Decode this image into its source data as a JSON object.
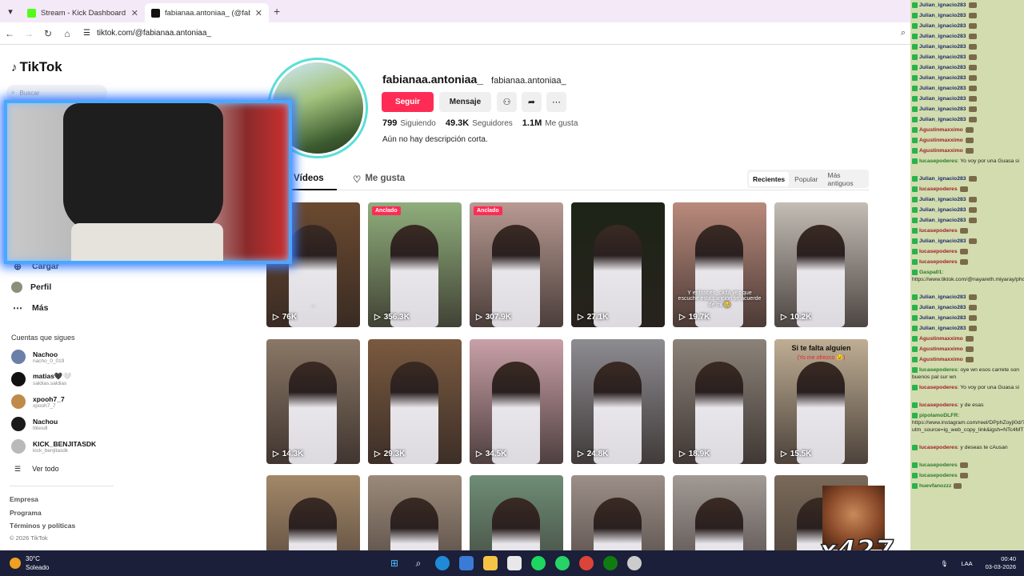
{
  "browser": {
    "tabs": [
      {
        "title": "Stream - Kick Dashboard",
        "favicon_color": "#53fc18"
      },
      {
        "title": "fabianaa.antoniaa_ (@fabia",
        "favicon_color": "#111111"
      }
    ],
    "url": "tiktok.com/@fabianaa.antoniaa_"
  },
  "sidebar": {
    "logo": "TikTok",
    "search_placeholder": "Buscar",
    "nav": [
      {
        "label": "Cargar",
        "icon": "upload-icon"
      },
      {
        "label": "Perfil",
        "icon": "profile-icon"
      },
      {
        "label": "Más",
        "icon": "more-icon"
      }
    ],
    "following_title": "Cuentas que sigues",
    "following": [
      {
        "name": "Nachoo",
        "handle": "nacho_0_019",
        "color": "#6c7fa8"
      },
      {
        "name": "matias🖤🤍",
        "handle": "saldias.saldias",
        "color": "#111111"
      },
      {
        "name": "xpooh7_7",
        "handle": "xpooh7_7",
        "color": "#c08a4a"
      },
      {
        "name": "Nachou",
        "handle": "lblesdl",
        "color": "#1a1a1a"
      },
      {
        "name": "KICK_BENJITASDK",
        "handle": "kick_benjitasdk",
        "color": "#b9b9b9"
      }
    ],
    "see_all": "Ver todo",
    "footer": [
      "Empresa",
      "Programa",
      "Términos y políticas"
    ],
    "copyright": "© 2026 TikTok"
  },
  "profile": {
    "username": "fabianaa.antoniaa_",
    "nickname": "fabianaa.antoniaa_",
    "follow_label": "Seguir",
    "message_label": "Mensaje",
    "stats": [
      {
        "value": "799",
        "label": "Siguiendo"
      },
      {
        "value": "49.3K",
        "label": "Seguidores"
      },
      {
        "value": "1.1M",
        "label": "Me gusta"
      }
    ],
    "bio": "Aún no hay descripción corta."
  },
  "tabs": {
    "videos": "Vídeos",
    "likes": "Me gusta"
  },
  "sort": [
    "Recientes",
    "Popular",
    "Más antiguos"
  ],
  "videos": [
    {
      "views": "76K",
      "pinned": "",
      "caption": "...",
      "bg": "#6b4a30"
    },
    {
      "views": "356.3K",
      "pinned": "Anclado",
      "caption": "",
      "bg": "#8fae7c"
    },
    {
      "views": "307.9K",
      "pinned": "Anclado",
      "caption": "",
      "bg": "#b89a92"
    },
    {
      "views": "27.1K",
      "pinned": "",
      "caption": "",
      "bg": "#1d2416"
    },
    {
      "views": "19.7K",
      "pinned": "",
      "caption": "Y entonces, cada vez que escuche esta canción se acuerde de mi 🥹",
      "bg": "#b98a7c"
    },
    {
      "views": "10.2K",
      "pinned": "",
      "caption": "",
      "bg": "#c4bdb5"
    },
    {
      "views": "14.3K",
      "pinned": "",
      "caption": "",
      "bg": "#8a7766"
    },
    {
      "views": "29.3K",
      "pinned": "",
      "caption": "",
      "bg": "#7a5a40"
    },
    {
      "views": "34.5K",
      "pinned": "",
      "caption": "",
      "bg": "#c9a0a8"
    },
    {
      "views": "24.8K",
      "pinned": "",
      "caption": "",
      "bg": "#8d8c91"
    },
    {
      "views": "18.9K",
      "pinned": "",
      "caption": "",
      "bg": "#8b8279"
    },
    {
      "views": "15.5K",
      "pinned": "",
      "caption": "",
      "bg": "#bfae94",
      "headline": "Si te falta alguien",
      "sub": "(Yo me ofrezco 😉)"
    },
    {
      "views": "",
      "pinned": "",
      "caption": "",
      "bg": "#a38869"
    },
    {
      "views": "",
      "pinned": "",
      "caption": "",
      "bg": "#9b8a7a"
    },
    {
      "views": "",
      "pinned": "",
      "caption": "",
      "bg": "#6e8d76"
    },
    {
      "views": "",
      "pinned": "",
      "caption": "",
      "bg": "#9c8f88"
    },
    {
      "views": "",
      "pinned": "",
      "caption": "",
      "bg": "#a29a95"
    },
    {
      "views": "",
      "pinned": "",
      "caption": "",
      "bg": "#7a6a5a"
    }
  ],
  "chat": [
    {
      "user": "Julian_ignacio283",
      "text": "",
      "c": "u"
    },
    {
      "user": "Julian_ignacio283",
      "text": "",
      "c": "u"
    },
    {
      "user": "Julian_ignacio283",
      "text": "",
      "c": "u"
    },
    {
      "user": "Julian_ignacio283",
      "text": "",
      "c": "u"
    },
    {
      "user": "Julian_ignacio283",
      "text": "",
      "c": "u"
    },
    {
      "user": "Julian_ignacio283",
      "text": "",
      "c": "u"
    },
    {
      "user": "Julian_ignacio283",
      "text": "",
      "c": "u"
    },
    {
      "user": "Julian_ignacio283",
      "text": "",
      "c": "u"
    },
    {
      "user": "Julian_ignacio283",
      "text": "",
      "c": "u"
    },
    {
      "user": "Julian_ignacio283",
      "text": "",
      "c": "u"
    },
    {
      "user": "Julian_ignacio283",
      "text": "",
      "c": "u"
    },
    {
      "user": "Julian_ignacio283",
      "text": "",
      "c": "u"
    },
    {
      "user": "Agustinmaxximo",
      "text": "",
      "c": "red"
    },
    {
      "user": "Agustinmaxximo",
      "text": "",
      "c": "red"
    },
    {
      "user": "Agustinmaxximo",
      "text": "",
      "c": "red"
    },
    {
      "user": "lucasepoderes",
      "text": ": Yo voy por una Guasa si",
      "c": "grn"
    },
    {
      "user": "Julian_ignacio283",
      "text": "",
      "c": "u"
    },
    {
      "user": "lucasepoderes",
      "text": "",
      "c": "red"
    },
    {
      "user": "Julian_ignacio283",
      "text": "",
      "c": "u"
    },
    {
      "user": "Julian_ignacio283",
      "text": "",
      "c": "u"
    },
    {
      "user": "Julian_ignacio283",
      "text": "",
      "c": "u"
    },
    {
      "user": "lucasepoderes",
      "text": "",
      "c": "red"
    },
    {
      "user": "Julian_ignacio283",
      "text": "",
      "c": "u"
    },
    {
      "user": "lucasepoderes",
      "text": "",
      "c": "red"
    },
    {
      "user": "lucasepoderes",
      "text": "",
      "c": "red"
    },
    {
      "user": "Gaspa01",
      "text": ": https://www.tiktok.com/@nayareth.miyaray/photo/75961840675559570",
      "c": "grn"
    },
    {
      "user": "Julian_ignacio283",
      "text": "",
      "c": "u"
    },
    {
      "user": "Julian_ignacio283",
      "text": "",
      "c": "u"
    },
    {
      "user": "Julian_ignacio283",
      "text": "",
      "c": "u"
    },
    {
      "user": "Julian_ignacio283",
      "text": "",
      "c": "u"
    },
    {
      "user": "Agustinmaxximo",
      "text": "",
      "c": "red"
    },
    {
      "user": "Agustinmaxximo",
      "text": "",
      "c": "red"
    },
    {
      "user": "Agustinmaxximo",
      "text": "",
      "c": "red"
    },
    {
      "user": "lucasepoderes",
      "text": ": oye wn esos carrete son buenos pal sur wn",
      "c": "grn"
    },
    {
      "user": "lucasepoderes",
      "text": ": Yo voy por una Guasa si",
      "c": "red"
    },
    {
      "user": "lucasepoderes",
      "text": ": y de esas",
      "c": "red"
    },
    {
      "user": "pipolamoDLFR",
      "text": ": https://www.instagram.com/reel/DPphZoyjI0d/?utm_source=ig_web_copy_link&igsh=NTc4MTIwNjQ2YQ==",
      "c": "grn"
    },
    {
      "user": "lucasepoderes",
      "text": ": y deseas te cAusan",
      "c": "red"
    },
    {
      "user": "lucasepoderes",
      "text": "",
      "c": "grn"
    },
    {
      "user": "lucasepoderes",
      "text": "",
      "c": "grn"
    },
    {
      "user": "huevfanozzz",
      "text": "",
      "c": "grn"
    }
  ],
  "meme_count": "x427",
  "taskbar": {
    "temp": "30°C",
    "weather": "Soleado",
    "lang": "LAA",
    "date": "03-03-2026",
    "time": "00:40"
  },
  "colors": {
    "accent": "#fe2c55",
    "chat_bg": "#d2dcae",
    "taskbar": "#1b1f3a"
  }
}
